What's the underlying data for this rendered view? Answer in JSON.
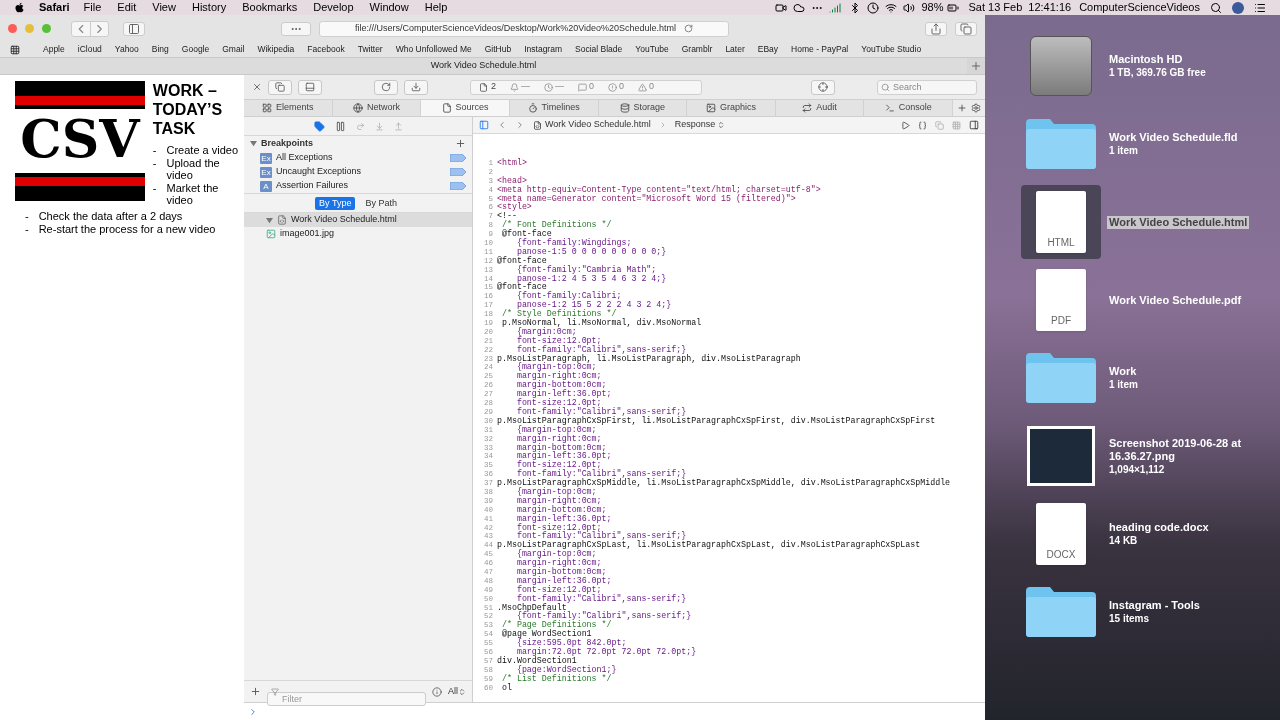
{
  "menu_bar": {
    "app": "Safari",
    "menus": [
      "File",
      "Edit",
      "View",
      "History",
      "Bookmarks",
      "Develop",
      "Window",
      "Help"
    ],
    "battery": "98%",
    "date": "Sat 13 Feb",
    "time": "12:41:16",
    "user": "ComputerScienceVideos"
  },
  "browser": {
    "address": "file:///Users/ComputerScienceVideos/Desktop/Work%20Video%20Schedule.html",
    "bookmarks": [
      "Apple",
      "iCloud",
      "Yahoo",
      "Bing",
      "Google",
      "Gmail",
      "Wikipedia",
      "Facebook",
      "Twitter",
      "Who Unfollowed Me",
      "GitHub",
      "Instagram",
      "Social Blade",
      "YouTube",
      "Gramblr",
      "Later",
      "EBay",
      "Home - PayPal",
      "YouTube Studio"
    ],
    "tab_title": "Work Video Schedule.html"
  },
  "document": {
    "logo_text": "CSV",
    "heading": "WORK – TODAY’S TASK",
    "items_beside_logo": [
      {
        "marker": "-",
        "text": "Create a video"
      },
      {
        "marker": "-",
        "text": "Upload the video"
      },
      {
        "marker": "-",
        "text": "Market the video"
      }
    ],
    "items_below": [
      {
        "marker": "-",
        "text": "Check the data after a 2 days"
      },
      {
        "marker": "-",
        "text": "Re-start the process for a new video"
      }
    ]
  },
  "inspector": {
    "toolbar": {
      "resources": "2",
      "notices": "—",
      "timers": "—",
      "logs": "0",
      "errors": "0",
      "warnings": "0",
      "search_placeholder": "Search"
    },
    "tabs": [
      {
        "label": "Elements",
        "selected": false
      },
      {
        "label": "Network",
        "selected": false
      },
      {
        "label": "Sources",
        "selected": true
      },
      {
        "label": "Timelines",
        "selected": false
      },
      {
        "label": "Storage",
        "selected": false
      },
      {
        "label": "Graphics",
        "selected": false
      },
      {
        "label": "Audit",
        "selected": false
      },
      {
        "label": "Console",
        "selected": false
      }
    ],
    "breakpoints": {
      "title": "Breakpoints",
      "items": [
        {
          "badge": "Ex",
          "label": "All Exceptions"
        },
        {
          "badge": "Ex",
          "label": "Uncaught Exceptions"
        },
        {
          "badge": "A",
          "label": "Assertion Failures"
        }
      ]
    },
    "sort_modes": [
      {
        "label": "By Type",
        "selected": true
      },
      {
        "label": "By Path",
        "selected": false
      }
    ],
    "resources": [
      {
        "label": "Work Video Schedule.html",
        "expanded": true,
        "selected": true,
        "children": [
          {
            "label": "image001.jpg",
            "selected": false
          }
        ]
      }
    ],
    "filter": {
      "placeholder": "Filter",
      "scope": "All"
    },
    "editor": {
      "file": "Work Video Schedule.html",
      "mode": "Response",
      "lines": [
        {
          "n": "1",
          "kind": "tag",
          "text": "<html>"
        },
        {
          "n": "2",
          "kind": "blank"
        },
        {
          "n": "3",
          "kind": "tag",
          "text": "<head>"
        },
        {
          "n": "4",
          "kind": "tag",
          "text": "<meta http-equiv=Content-Type content=\"text/html; charset=utf-8\">"
        },
        {
          "n": "5",
          "kind": "tag",
          "text": "<meta name=Generator content=\"Microsoft Word 15 (filtered)\">"
        },
        {
          "n": "6",
          "kind": "tag",
          "text": "<style>"
        },
        {
          "n": "7",
          "kind": "plain",
          "text": "<!--"
        },
        {
          "n": "8",
          "kind": "comment",
          "text": " /* Font Definitions */"
        },
        {
          "n": "9",
          "kind": "plain",
          "text": " @font-face"
        },
        {
          "n": "10",
          "kind": "prop",
          "text": "    {font-family:Wingdings;"
        },
        {
          "n": "11",
          "kind": "prop",
          "text": "    panose-1:5 0 0 0 0 0 0 0 0 0;}"
        },
        {
          "n": "12",
          "kind": "plain",
          "text": "@font-face"
        },
        {
          "n": "13",
          "kind": "prop",
          "text": "    {font-family:\"Cambria Math\";"
        },
        {
          "n": "14",
          "kind": "prop",
          "text": "    panose-1:2 4 5 3 5 4 6 3 2 4;}"
        },
        {
          "n": "15",
          "kind": "plain",
          "text": "@font-face"
        },
        {
          "n": "16",
          "kind": "prop",
          "text": "    {font-family:Calibri;"
        },
        {
          "n": "17",
          "kind": "prop",
          "text": "    panose-1:2 15 5 2 2 2 4 3 2 4;}"
        },
        {
          "n": "18",
          "kind": "comment",
          "text": " /* Style Definitions */"
        },
        {
          "n": "19",
          "kind": "plain",
          "text": " p.MsoNormal, li.MsoNormal, div.MsoNormal"
        },
        {
          "n": "20",
          "kind": "prop",
          "text": "    {margin:0cm;"
        },
        {
          "n": "21",
          "kind": "prop",
          "text": "    font-size:12.0pt;"
        },
        {
          "n": "22",
          "kind": "prop",
          "text": "    font-family:\"Calibri\",sans-serif;}"
        },
        {
          "n": "23",
          "kind": "plain",
          "text": "p.MsoListParagraph, li.MsoListParagraph, div.MsoListParagraph"
        },
        {
          "n": "24",
          "kind": "prop",
          "text": "    {margin-top:0cm;"
        },
        {
          "n": "25",
          "kind": "prop",
          "text": "    margin-right:0cm;"
        },
        {
          "n": "26",
          "kind": "prop",
          "text": "    margin-bottom:0cm;"
        },
        {
          "n": "27",
          "kind": "prop",
          "text": "    margin-left:36.0pt;"
        },
        {
          "n": "28",
          "kind": "prop",
          "text": "    font-size:12.0pt;"
        },
        {
          "n": "29",
          "kind": "prop",
          "text": "    font-family:\"Calibri\",sans-serif;}"
        },
        {
          "n": "30",
          "kind": "plain",
          "text": "p.MsoListParagraphCxSpFirst, li.MsoListParagraphCxSpFirst, div.MsoListParagraphCxSpFirst"
        },
        {
          "n": "31",
          "kind": "prop",
          "text": "    {margin-top:0cm;"
        },
        {
          "n": "32",
          "kind": "prop",
          "text": "    margin-right:0cm;"
        },
        {
          "n": "33",
          "kind": "prop",
          "text": "    margin-bottom:0cm;"
        },
        {
          "n": "34",
          "kind": "prop",
          "text": "    margin-left:36.0pt;"
        },
        {
          "n": "35",
          "kind": "prop",
          "text": "    font-size:12.0pt;"
        },
        {
          "n": "36",
          "kind": "prop",
          "text": "    font-family:\"Calibri\",sans-serif;}"
        },
        {
          "n": "37",
          "kind": "plain",
          "text": "p.MsoListParagraphCxSpMiddle, li.MsoListParagraphCxSpMiddle, div.MsoListParagraphCxSpMiddle"
        },
        {
          "n": "38",
          "kind": "prop",
          "text": "    {margin-top:0cm;"
        },
        {
          "n": "39",
          "kind": "prop",
          "text": "    margin-right:0cm;"
        },
        {
          "n": "40",
          "kind": "prop",
          "text": "    margin-bottom:0cm;"
        },
        {
          "n": "41",
          "kind": "prop",
          "text": "    margin-left:36.0pt;"
        },
        {
          "n": "42",
          "kind": "prop",
          "text": "    font-size:12.0pt;"
        },
        {
          "n": "43",
          "kind": "prop",
          "text": "    font-family:\"Calibri\",sans-serif;}"
        },
        {
          "n": "44",
          "kind": "plain",
          "text": "p.MsoListParagraphCxSpLast, li.MsoListParagraphCxSpLast, div.MsoListParagraphCxSpLast"
        },
        {
          "n": "45",
          "kind": "prop",
          "text": "    {margin-top:0cm;"
        },
        {
          "n": "46",
          "kind": "prop",
          "text": "    margin-right:0cm;"
        },
        {
          "n": "47",
          "kind": "prop",
          "text": "    margin-bottom:0cm;"
        },
        {
          "n": "48",
          "kind": "prop",
          "text": "    margin-left:36.0pt;"
        },
        {
          "n": "49",
          "kind": "prop",
          "text": "    font-size:12.0pt;"
        },
        {
          "n": "50",
          "kind": "prop",
          "text": "    font-family:\"Calibri\",sans-serif;}"
        },
        {
          "n": "51",
          "kind": "plain",
          "text": ".MsoChpDefault"
        },
        {
          "n": "52",
          "kind": "prop",
          "text": "    {font-family:\"Calibri\",sans-serif;}"
        },
        {
          "n": "53",
          "kind": "comment",
          "text": " /* Page Definitions */"
        },
        {
          "n": "54",
          "kind": "plain",
          "text": " @page WordSection1"
        },
        {
          "n": "55",
          "kind": "prop",
          "text": "    {size:595.0pt 842.0pt;"
        },
        {
          "n": "56",
          "kind": "prop",
          "text": "    margin:72.0pt 72.0pt 72.0pt 72.0pt;}"
        },
        {
          "n": "57",
          "kind": "plain",
          "text": "div.WordSection1"
        },
        {
          "n": "58",
          "kind": "prop",
          "text": "    {page:WordSection1;}"
        },
        {
          "n": "59",
          "kind": "comment",
          "text": " /* List Definitions */"
        },
        {
          "n": "60",
          "kind": "plain",
          "text": " ol"
        }
      ]
    }
  },
  "desktop": {
    "items": [
      {
        "kind": "drive",
        "name": "Macintosh HD",
        "detail": "1 TB, 369.76 GB free",
        "selected": false
      },
      {
        "kind": "folder",
        "name": "Work Video Schedule.fld",
        "detail": "1 item",
        "selected": false
      },
      {
        "kind": "document",
        "badge": "HTML",
        "name": "Work Video Schedule.html",
        "selected": true
      },
      {
        "kind": "document",
        "badge": "PDF",
        "name": "Work Video Schedule.pdf",
        "selected": false
      },
      {
        "kind": "folder",
        "name": "Work",
        "detail": "1 item",
        "selected": false
      },
      {
        "kind": "image",
        "name": "Screenshot 2019-06-28 at 16.36.27.png",
        "detail": "1,094×1,112",
        "selected": false
      },
      {
        "kind": "document",
        "badge": "DOCX",
        "name": "heading code.docx",
        "detail": "14 KB",
        "selected": false
      },
      {
        "kind": "folder",
        "name": "Instagram - Tools",
        "detail": "15 items",
        "selected": false
      }
    ]
  }
}
